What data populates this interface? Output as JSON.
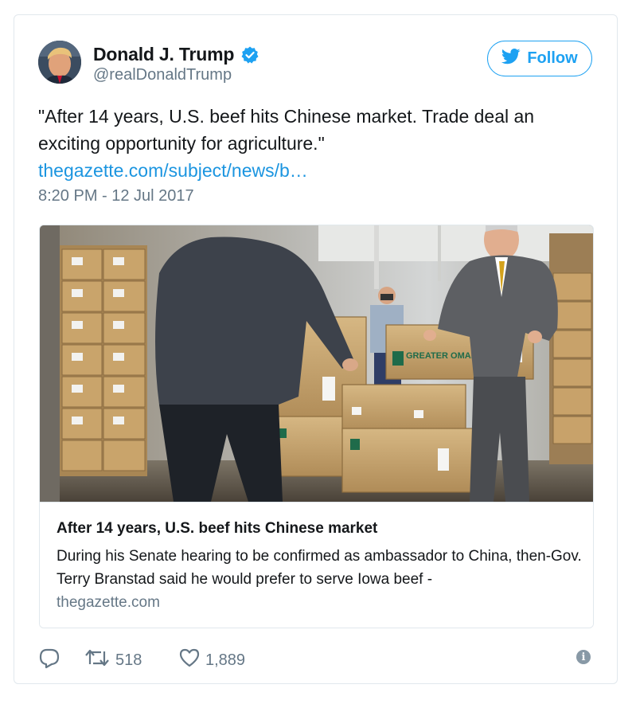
{
  "author": {
    "name": "Donald J. Trump",
    "handle": "@realDonaldTrump",
    "verified": true
  },
  "follow_button": {
    "label": "Follow"
  },
  "tweet": {
    "text": "\"After 14 years, U.S. beef hits Chinese market. Trade deal an exciting opportunity for agriculture.\"",
    "link": "thegazette.com/subject/news/b…",
    "timestamp": "8:20 PM - 12 Jul 2017"
  },
  "link_card": {
    "title": "After 14 years, U.S. beef hits Chinese market",
    "description": "During his Senate hearing to be confirmed as ambassador to China, then-Gov. Terry Branstad said he would prefer to serve Iowa beef -",
    "domain": "thegazette.com",
    "box_brand": "GREATER OMAHA"
  },
  "actions": {
    "retweets": "518",
    "likes": "1,889"
  },
  "colors": {
    "accent": "#1da1f2",
    "link": "#1b95e0",
    "muted": "#657786",
    "border": "#e1e8ed"
  },
  "icons": [
    "verified-badge-icon",
    "twitter-bird-icon",
    "reply-icon",
    "retweet-icon",
    "like-icon",
    "info-icon"
  ]
}
